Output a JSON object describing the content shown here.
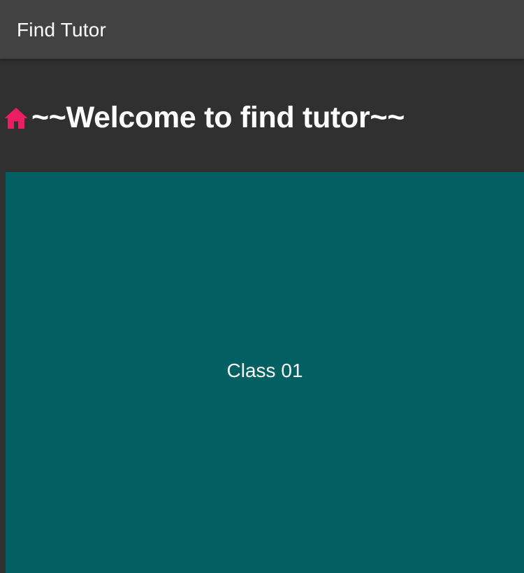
{
  "app_bar": {
    "title": "Find Tutor"
  },
  "welcome": {
    "icon": "home-icon",
    "icon_color": "#E91E63",
    "text": "~~Welcome to find tutor~~"
  },
  "classes": [
    {
      "label": "Class 01",
      "color": "#026063"
    }
  ],
  "colors": {
    "background": "#303030",
    "app_bar": "#424242",
    "text": "#FFFFFF"
  }
}
